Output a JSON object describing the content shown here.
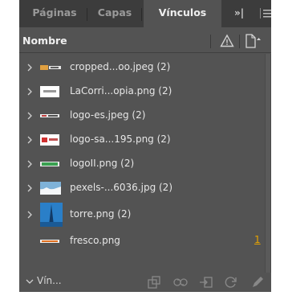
{
  "tabs": [
    {
      "label": "Páginas"
    },
    {
      "label": "Capas"
    },
    {
      "label": "Vínculos"
    }
  ],
  "tabbar": {
    "more_label": "»|"
  },
  "header": {
    "column_label": "Nombre"
  },
  "links": [
    {
      "name": "cropped...oo.jpeg (2)",
      "expandable": true,
      "thumb_icon": "thumb-cropped-icon"
    },
    {
      "name": "LaCorri...opia.png (2)",
      "expandable": true,
      "thumb_icon": "thumb-lacorri-icon"
    },
    {
      "name": "logo-es.jpeg (2)",
      "expandable": true,
      "thumb_icon": "thumb-logo-es-icon"
    },
    {
      "name": "logo-sa...195.png (2)",
      "expandable": true,
      "thumb_icon": "thumb-logo-sa-icon"
    },
    {
      "name": "logoII.png (2)",
      "expandable": true,
      "thumb_icon": "thumb-logoII-icon"
    },
    {
      "name": "pexels-...6036.jpg (2)",
      "expandable": true,
      "thumb_icon": "thumb-pexels-icon"
    },
    {
      "name": "torre.png (2)",
      "expandable": true,
      "thumb_icon": "thumb-torre-icon"
    },
    {
      "name": "fresco.png",
      "expandable": false,
      "thumb_icon": "thumb-fresco-icon",
      "page": "1"
    }
  ],
  "footer": {
    "label": "Vín..."
  },
  "colors": {
    "panel_bg": "#535353",
    "tabbar_bg": "#3c3c3c",
    "page_number": "#e6a300"
  }
}
